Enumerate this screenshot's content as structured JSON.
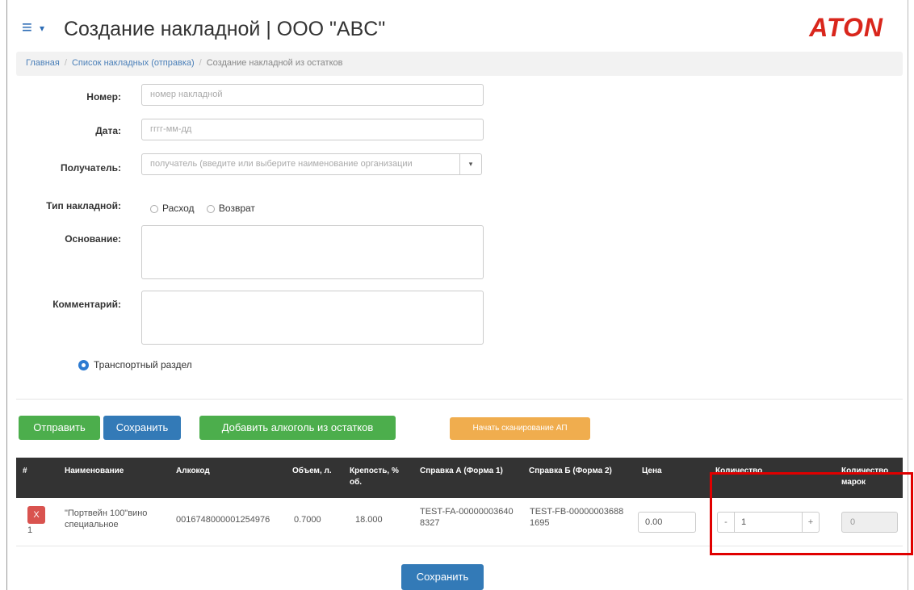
{
  "header": {
    "menu_icon": "hamburger-icon",
    "title": "Создание накладной | ООО \"ABC\"",
    "logo": "ATON"
  },
  "breadcrumb": {
    "items": [
      "Главная",
      "Список накладных (отправка)",
      "Создание накладной из остатков"
    ]
  },
  "form": {
    "number_label": "Номер:",
    "number_placeholder": "номер накладной",
    "date_label": "Дата:",
    "date_placeholder": "гггг-мм-дд",
    "recipient_label": "Получатель:",
    "recipient_placeholder": "получатель (введите или выберите наименование организации",
    "type_label": "Тип накладной:",
    "type_options": [
      "Расход",
      "Возврат"
    ],
    "basis_label": "Основание:",
    "comment_label": "Комментарий:",
    "transport_label": "Транспортный раздел"
  },
  "actions": {
    "send": "Отправить",
    "save": "Сохранить",
    "add_from_stock": "Добавить алкоголь из остатков",
    "start_scan": "Начать сканирование АП",
    "save_bottom": "Сохранить"
  },
  "table": {
    "headers": [
      "#",
      "Наименование",
      "Алкокод",
      "Объем, л.",
      "Крепость, % об.",
      "Справка А (Форма 1)",
      "Справка Б (Форма 2)",
      "Цена",
      "Количество",
      "Количество марок"
    ],
    "rows": [
      {
        "num": "1",
        "delete_label": "X",
        "name": "\"Портвейн 100\"вино специальное",
        "alcocode": "0016748000001254976",
        "volume": "0.7000",
        "strength": "18.000",
        "ref_a": "TEST-FA-000000036408327",
        "ref_b": "TEST-FB-000000036881695",
        "price": "0.00",
        "quantity": "1",
        "quantity_minus": "-",
        "quantity_plus": "+",
        "marks_count": "0"
      }
    ]
  },
  "colors": {
    "highlight": "#e00000",
    "logo": "#d9261c"
  }
}
